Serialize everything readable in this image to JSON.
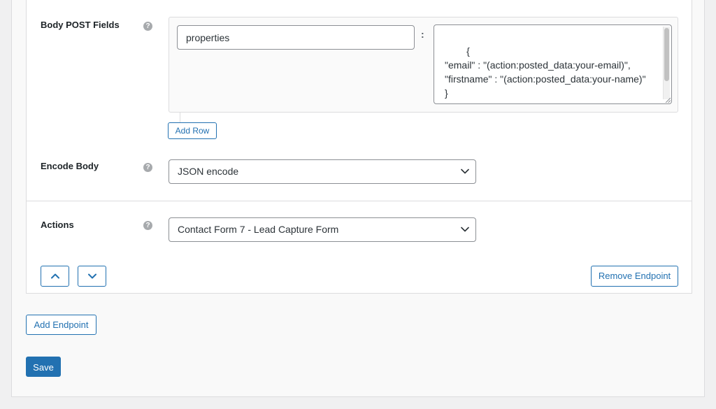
{
  "endpoint": {
    "body_post_fields": {
      "label": "Body POST Fields",
      "help_glyph": "?",
      "row": {
        "key": "properties",
        "separator": ":",
        "value": "{\n\"email\" : \"(action:posted_data:your-email)\",\n\"firstname\" : \"(action:posted_data:your-name)\"\n}"
      },
      "add_row_label": "Add Row"
    },
    "encode_body": {
      "label": "Encode Body",
      "help_glyph": "?",
      "selected": "JSON encode"
    },
    "actions": {
      "label": "Actions",
      "help_glyph": "?",
      "selected": "Contact Form 7 - Lead Capture Form"
    },
    "move_up_icon": "chevron-up-icon",
    "move_down_icon": "chevron-down-icon",
    "remove_label": "Remove Endpoint"
  },
  "add_endpoint_label": "Add Endpoint",
  "save_label": "Save",
  "colors": {
    "primary": "#2271b1",
    "border": "#dcdcde",
    "label_text": "#1d2327",
    "help_icon": "#a7aaad"
  }
}
